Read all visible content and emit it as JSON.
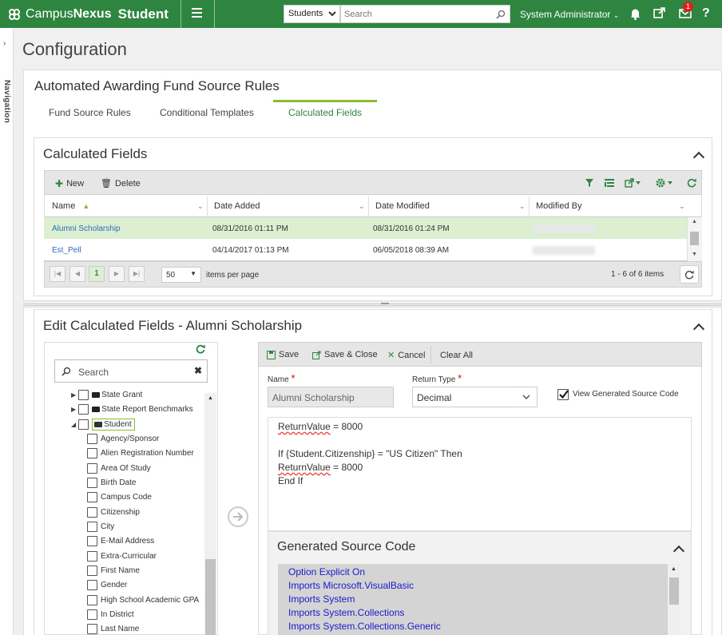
{
  "app": {
    "brand_light": "Campus",
    "brand_bold": "Nexus",
    "brand_product": "Student"
  },
  "topbar": {
    "search_scope": "Students",
    "search_placeholder": "Search",
    "user": "System Administrator",
    "notification_count": "1",
    "help_label": "?"
  },
  "rail": {
    "label": "Navigation"
  },
  "page": {
    "title": "Configuration"
  },
  "rules": {
    "title": "Automated Awarding Fund Source Rules",
    "tabs": [
      {
        "label": "Fund Source Rules"
      },
      {
        "label": "Conditional Templates"
      },
      {
        "label": "Calculated Fields"
      }
    ],
    "active_tab": 2
  },
  "calc": {
    "title": "Calculated Fields",
    "new_label": "New",
    "delete_label": "Delete",
    "columns": [
      "Name",
      "Date Added",
      "Date Modified",
      "Modified By"
    ],
    "rows": [
      {
        "name": "Alumni Scholarship",
        "added": "08/31/2016 01:11 PM",
        "modified": "08/31/2016 01:24 PM"
      },
      {
        "name": "Est_Pell",
        "added": "04/14/2017 01:13 PM",
        "modified": "06/05/2018 08:39 AM"
      }
    ],
    "pager": {
      "page": "1",
      "page_size": "50",
      "items_per_page": "items per page",
      "summary": "1 - 6 of 6 items"
    }
  },
  "edit": {
    "title": "Edit Calculated Fields - Alumni Scholarship",
    "tree_search_placeholder": "Search",
    "tree_folders": [
      "State Grant",
      "State Report Benchmarks",
      "Student"
    ],
    "tree_items": [
      "Agency/Sponsor",
      "Alien Registration Number",
      "Area Of Study",
      "Birth Date",
      "Campus Code",
      "Citizenship",
      "City",
      "E-Mail Address",
      "Extra-Curricular",
      "First Name",
      "Gender",
      "High School Academic GPA",
      "In District",
      "Last Name"
    ],
    "actions": {
      "save": "Save",
      "save_close": "Save & Close",
      "cancel": "Cancel",
      "clear_all": "Clear All"
    },
    "name_label": "Name",
    "name_value": "Alumni Scholarship",
    "return_type_label": "Return Type",
    "return_type_value": "Decimal",
    "view_generated_label": "View Generated Source Code",
    "view_generated_checked": true,
    "code": {
      "line1_var": "ReturnValue",
      "line1_rest": " = 8000",
      "line2": "If {Student.Citizenship} = \"US Citizen\" Then",
      "line3_var": "ReturnValue",
      "line3_rest": " = 8000",
      "line4": "End If"
    },
    "generated": {
      "title": "Generated Source Code",
      "lines": [
        "Option Explicit On",
        "Imports Microsoft.VisualBasic",
        "Imports System",
        "Imports System.Collections",
        "Imports System.Collections.Generic"
      ]
    }
  },
  "colors": {
    "brand": "#2e8540",
    "accent_tab": "#8dbb2e",
    "row_selected": "#dcefd1",
    "link": "#2a6ebb"
  }
}
